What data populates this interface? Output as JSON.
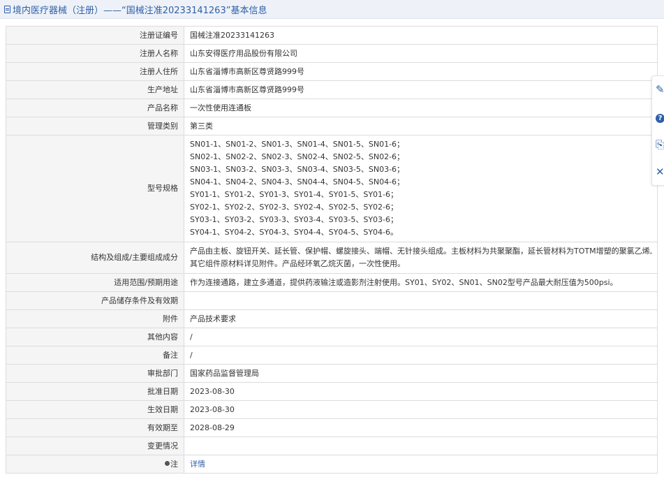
{
  "header": {
    "title": "境内医疗器械（注册）——“国械注准20233141263”基本信息"
  },
  "rows": [
    {
      "label": "注册证编号",
      "value": "国械注准20233141263"
    },
    {
      "label": "注册人名称",
      "value": "山东安得医疗用品股份有限公司"
    },
    {
      "label": "注册人住所",
      "value": "山东省淄博市高新区尊贤路999号"
    },
    {
      "label": "生产地址",
      "value": "山东省淄博市高新区尊贤路999号"
    },
    {
      "label": "产品名称",
      "value": "一次性使用连通板"
    },
    {
      "label": "管理类别",
      "value": "第三类"
    }
  ],
  "model": {
    "label": "型号规格",
    "lines": [
      "SN01-1、SN01-2、SN01-3、SN01-4、SN01-5、SN01-6；",
      "SN02-1、SN02-2、SN02-3、SN02-4、SN02-5、SN02-6；",
      "SN03-1、SN03-2、SN03-3、SN03-4、SN03-5、SN03-6；",
      "SN04-1、SN04-2、SN04-3、SN04-4、SN04-5、SN04-6；",
      "SY01-1、SY01-2、SY01-3、SY01-4、SY01-5、SY01-6；",
      "SY02-1、SY02-2、SY02-3、SY02-4、SY02-5、SY02-6；",
      "SY03-1、SY03-2、SY03-3、SY03-4、SY03-5、SY03-6；",
      "SY04-1、SY04-2、SY04-3、SY04-4、SY04-5、SY04-6。"
    ]
  },
  "structure": {
    "label": "结构及组成/主要组成成分",
    "value": "产品由主板、旋钮开关、延长管、保护帽、螺旋接头、端帽、无针接头组成。主板材料为共聚聚酯，延长管材料为TOTM增塑的聚氯乙烯,其它组件原材料详见附件。产品经环氧乙烷灭菌，一次性使用。"
  },
  "rows2": [
    {
      "label": "适用范围/预期用途",
      "value": "作为连接通路，建立多通道，提供药液输注或造影剂注射使用。SY01、SY02、SN01、SN02型号产品最大耐压值为500psi。"
    },
    {
      "label": "产品储存条件及有效期",
      "value": ""
    },
    {
      "label": "附件",
      "value": "产品技术要求"
    },
    {
      "label": "其他内容",
      "value": "/"
    },
    {
      "label": "备注",
      "value": "/"
    },
    {
      "label": "审批部门",
      "value": "国家药品监督管理局"
    },
    {
      "label": "批准日期",
      "value": "2023-08-30"
    },
    {
      "label": "生效日期",
      "value": "2023-08-30"
    },
    {
      "label": "有效期至",
      "value": "2028-08-29"
    },
    {
      "label": "变更情况",
      "value": ""
    }
  ],
  "note": {
    "label": "注",
    "link": "详情"
  },
  "toolbar": {
    "edit_glyph": "✎",
    "help_glyph": "?",
    "copy_glyph": "⎘",
    "close_glyph": "✕"
  }
}
